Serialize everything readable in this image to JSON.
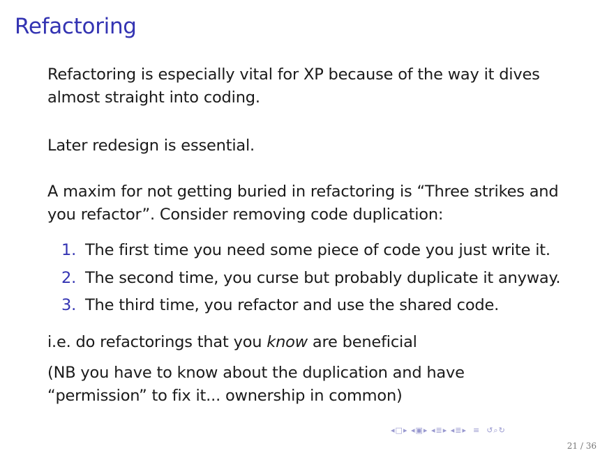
{
  "slide": {
    "title": "Refactoring",
    "para1": "Refactoring is especially vital for XP because of the way it dives almost straight into coding.",
    "para2": "Later redesign is essential.",
    "para3": "A maxim for not getting buried in refactoring is “Three strikes and you refactor”. Consider removing code duplication:",
    "list": [
      {
        "num": "1.",
        "text": "The first time you need some piece of code you just write it."
      },
      {
        "num": "2.",
        "text": "The second time, you curse but probably duplicate it anyway."
      },
      {
        "num": "3.",
        "text": "The third time, you refactor and use the shared code."
      }
    ],
    "para4_before": "i.e. do refactorings that you ",
    "para4_emph": "know",
    "para4_after": " are beneficial",
    "para5": "(NB you have to know about the duplication and have “permission” to fix it... ownership in common)"
  },
  "footer": {
    "page": "21 / 36",
    "nav_icons": [
      "prev-frame-icon",
      "frame-icon",
      "next-frame-icon",
      "prev-subsection-icon",
      "subsection-icon",
      "next-subsection-icon",
      "prev-section-icon",
      "section-icon",
      "next-section-icon",
      "align-icon",
      "search-icon"
    ]
  }
}
